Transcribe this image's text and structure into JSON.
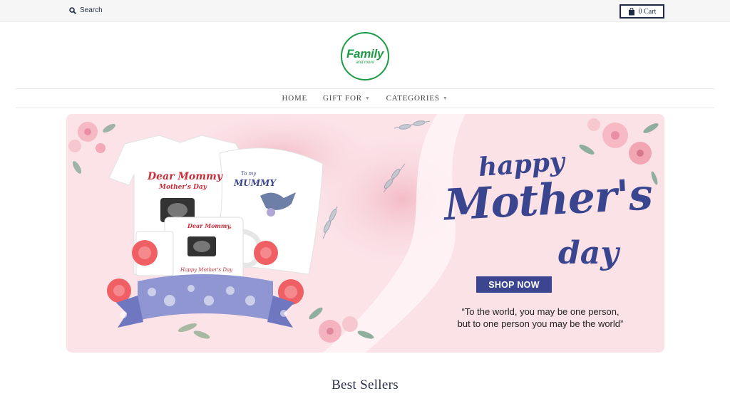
{
  "topbar": {
    "search_label": "Search",
    "cart_label": "0 Cart"
  },
  "logo": {
    "main": "Family",
    "sub": "and more"
  },
  "nav": {
    "items": [
      {
        "label": "HOME",
        "has_dropdown": false
      },
      {
        "label": "GIFT FOR",
        "has_dropdown": true
      },
      {
        "label": "CATEGORIES",
        "has_dropdown": true
      }
    ]
  },
  "hero": {
    "title_line1": "happy",
    "title_line2": "Mother's",
    "title_line3": "day",
    "cta_label": "SHOP NOW",
    "quote_line1": "“To the world, you may be one person,",
    "quote_line2": "but to one person you may be the world”",
    "shirt_text_1": "Dear Mommy",
    "shirt_text_2": "Mother's Day",
    "pillow_text_1": "To my",
    "pillow_text_2": "MUMMY",
    "mug_text_1": "Dear Mommy,",
    "mug_text_2": "Happy Mother's Day"
  },
  "sections": {
    "best_sellers_title": "Best Sellers"
  },
  "colors": {
    "brand_green": "#1e9b45",
    "navy": "#1f2a44",
    "hero_blue": "#3a4590",
    "hero_pink": "#fbe3e8"
  }
}
